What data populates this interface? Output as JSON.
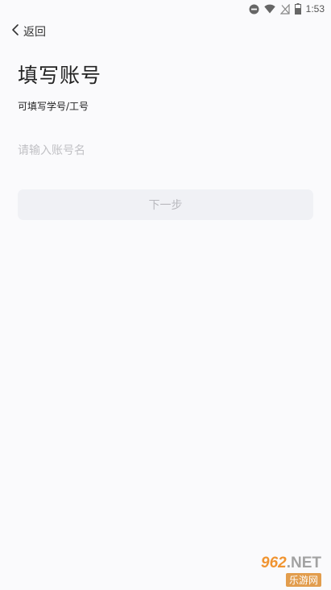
{
  "status_bar": {
    "time": "1:53",
    "icons": [
      "dnd-icon",
      "wifi-icon",
      "no-signal-icon",
      "battery-icon"
    ]
  },
  "header": {
    "back_label": "返回"
  },
  "main": {
    "title": "填写账号",
    "subtitle": "可填写学号/工号",
    "account_input": {
      "value": "",
      "placeholder": "请输入账号名"
    },
    "next_button_label": "下一步"
  },
  "watermark": {
    "brand": "962",
    "domain": ".NET",
    "site_name": "乐游网"
  },
  "colors": {
    "background": "#fafafc",
    "button_disabled_bg": "#f0f1f5",
    "button_disabled_text": "#b9b9be",
    "placeholder": "#c0c0c4",
    "watermark_accent": "#f08a1c"
  }
}
